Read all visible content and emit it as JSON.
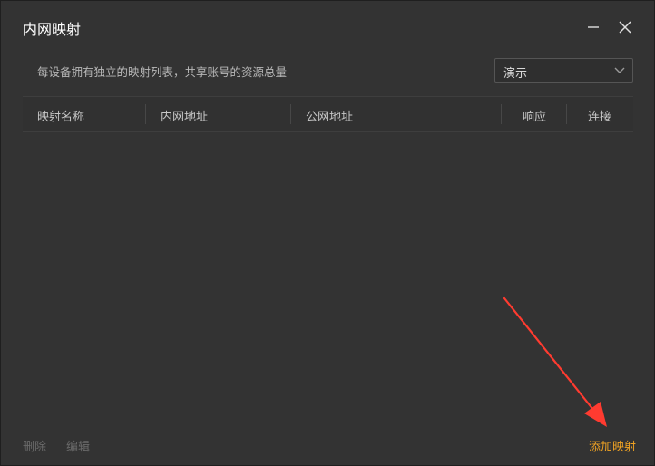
{
  "window": {
    "title": "内网映射"
  },
  "header": {
    "description": "每设备拥有独立的映射列表，共享账号的资源总量",
    "device_select": {
      "value": "演示"
    }
  },
  "table": {
    "columns": [
      "映射名称",
      "内网地址",
      "公网地址",
      "响应",
      "连接"
    ],
    "rows": []
  },
  "footer": {
    "delete_label": "删除",
    "edit_label": "编辑",
    "add_label": "添加映射"
  },
  "colors": {
    "background": "#333333",
    "accent": "#f0a323",
    "annotation_arrow": "#ff3b30"
  },
  "icons": [
    "minimize-icon",
    "close-icon",
    "chevron-down-icon",
    "annotation-arrow-icon"
  ]
}
